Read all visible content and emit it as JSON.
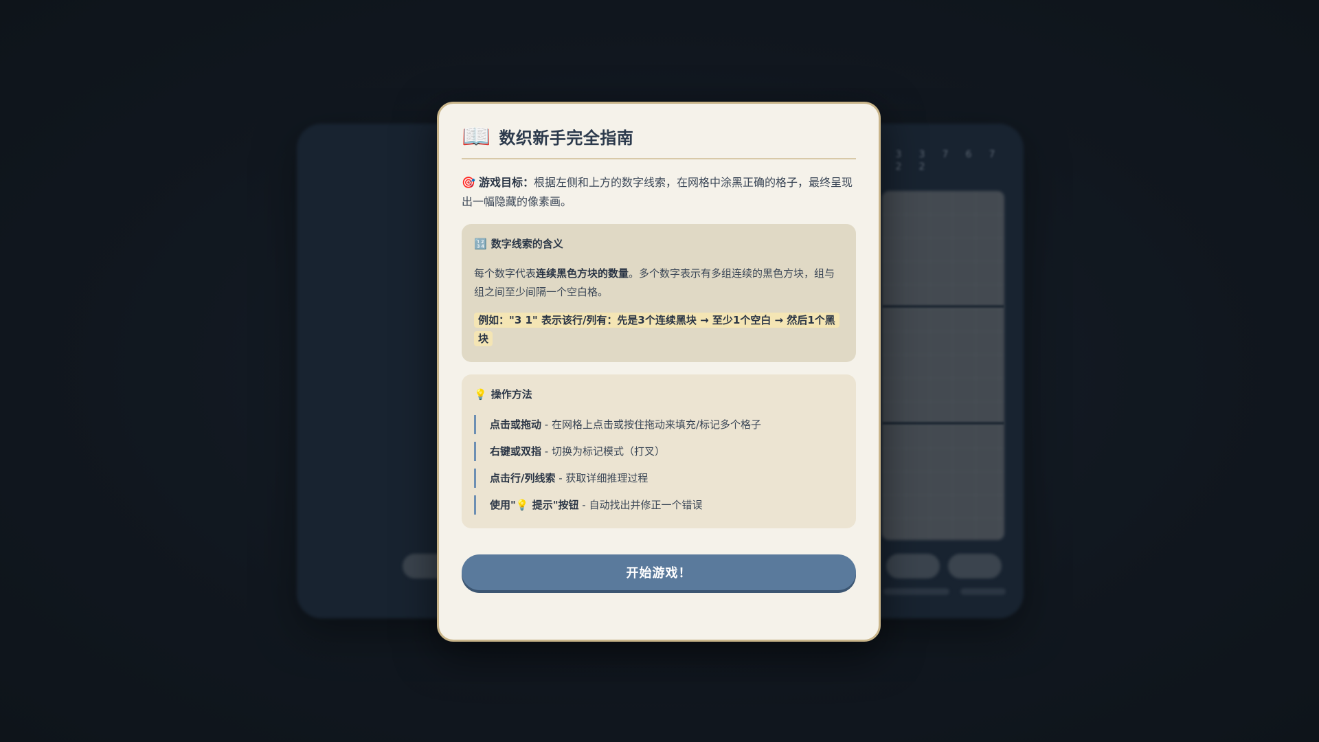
{
  "background": {
    "clues": [
      "3",
      "3",
      "7",
      "6",
      "7"
    ],
    "clues_second_row": [
      "2",
      "2"
    ]
  },
  "modal": {
    "header_icon": "📖",
    "title": "数织新手完全指南",
    "goal": {
      "icon": "🎯",
      "label": "游戏目标：",
      "text": "根据左侧和上方的数字线索，在网格中涂黑正确的格子，最终呈现出一幅隐藏的像素画。"
    },
    "clues_section": {
      "icon": "🔢",
      "title": "数字线索的含义",
      "text_before": "每个数字代表",
      "text_bold": "连续黑色方块的数量",
      "text_after": "。多个数字表示有多组连续的黑色方块，组与组之间至少间隔一个空白格。",
      "example": "例如：\"3 1\" 表示该行/列有：先是3个连续黑块 → 至少1个空白 → 然后1个黑块"
    },
    "ops_section": {
      "icon": "💡",
      "title": "操作方法",
      "items": [
        {
          "bold": "点击或拖动",
          "text": " - 在网格上点击或按住拖动来填充/标记多个格子"
        },
        {
          "bold": "右键或双指",
          "text": " - 切换为标记模式（打叉）"
        },
        {
          "bold": "点击行/列线索",
          "text": " - 获取详细推理过程"
        },
        {
          "bold": "使用\"💡 提示\"按钮",
          "text": " - 自动找出并修正一个错误"
        }
      ]
    },
    "start_button": "开始游戏！"
  },
  "colors": {
    "modal_bg": "#f5f2ea",
    "modal_border": "#c9b58a",
    "button": "#5a7a9c",
    "accent_line": "#6d8fb3",
    "highlight": "#f4e5b4"
  }
}
